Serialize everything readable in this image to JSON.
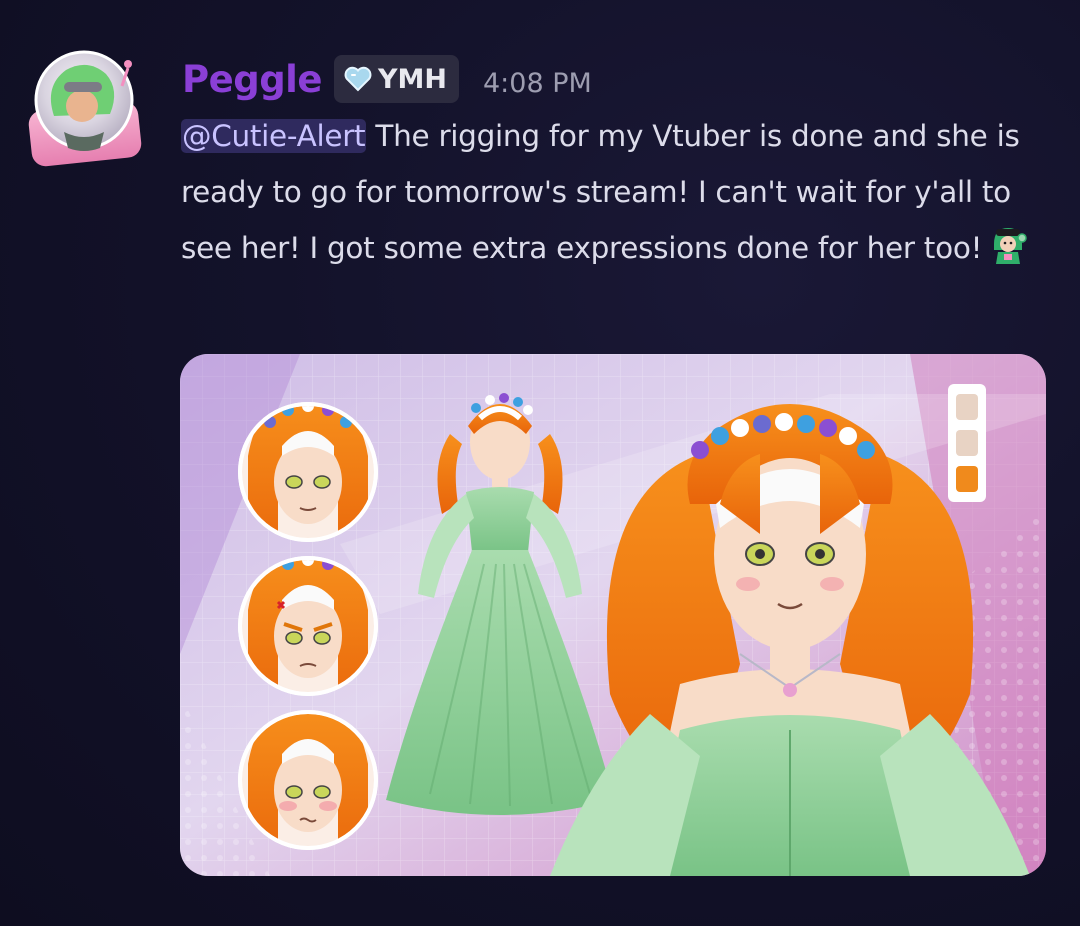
{
  "message": {
    "author": {
      "name": "Peggle",
      "name_color": "#8a3fd6",
      "role_tag": {
        "icon": "heart-icon",
        "label": "YMH"
      }
    },
    "timestamp": "4:08 PM",
    "mention": "@Cutie-Alert",
    "text": " The rigging for my Vtuber is done and she is ready to go for tomorrow's stream! I can't wait for y'all to see her! I got some extra expressions done for her too!",
    "emoji": "vtuber-custom-emoji",
    "attachment": {
      "type": "image",
      "subject": "vtuber-character-reference-sheet",
      "swatches": [
        "#e8d3c4",
        "#e8d3c4",
        "#f08a1c"
      ]
    }
  },
  "colors": {
    "background": "#13122a",
    "text": "#dcdcea",
    "timestamp": "#9d9db0",
    "mention_bg": "#2f2a5e",
    "mention_text": "#c9c3ff"
  }
}
